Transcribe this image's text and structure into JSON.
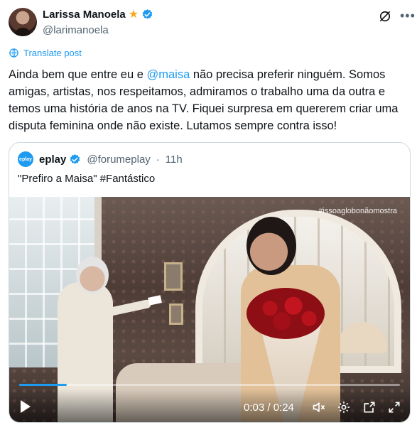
{
  "post": {
    "display_name": "Larissa Manoela",
    "handle": "@larimanoela",
    "translate_label": "Translate post",
    "text_before": "Ainda bem que entre eu e ",
    "mention": "@maisa",
    "text_after": " não precisa preferir ninguém. Somos amigas, artistas, nos respeitamos, admiramos o trabalho uma da outra e temos uma história de anos na TV. Fiquei surpresa em quererem criar uma disputa feminina onde não existe. Lutamos sempre contra isso!"
  },
  "quote": {
    "avatar_text": "eplay",
    "display_name": "eplay",
    "handle": "@forumeplay",
    "separator": "·",
    "time": "11h",
    "text": "\"Prefiro a Maisa\" #Fantástico"
  },
  "video": {
    "watermark": "#issoaglobonãomostra",
    "time_display": "0:03 / 0:24",
    "progress_fraction": 0.125
  },
  "icons": {
    "star": "star-icon",
    "verified": "verified-badge-icon",
    "grok": "grok-icon",
    "more": "more-icon",
    "translate": "translate-icon",
    "play": "play-icon",
    "mute": "mute-icon",
    "settings": "gear-icon",
    "pip": "pip-icon",
    "fullscreen": "fullscreen-icon"
  },
  "colors": {
    "accent": "#1d9bf0",
    "text": "#0f1419",
    "muted": "#536471",
    "star": "#f4a81d"
  }
}
